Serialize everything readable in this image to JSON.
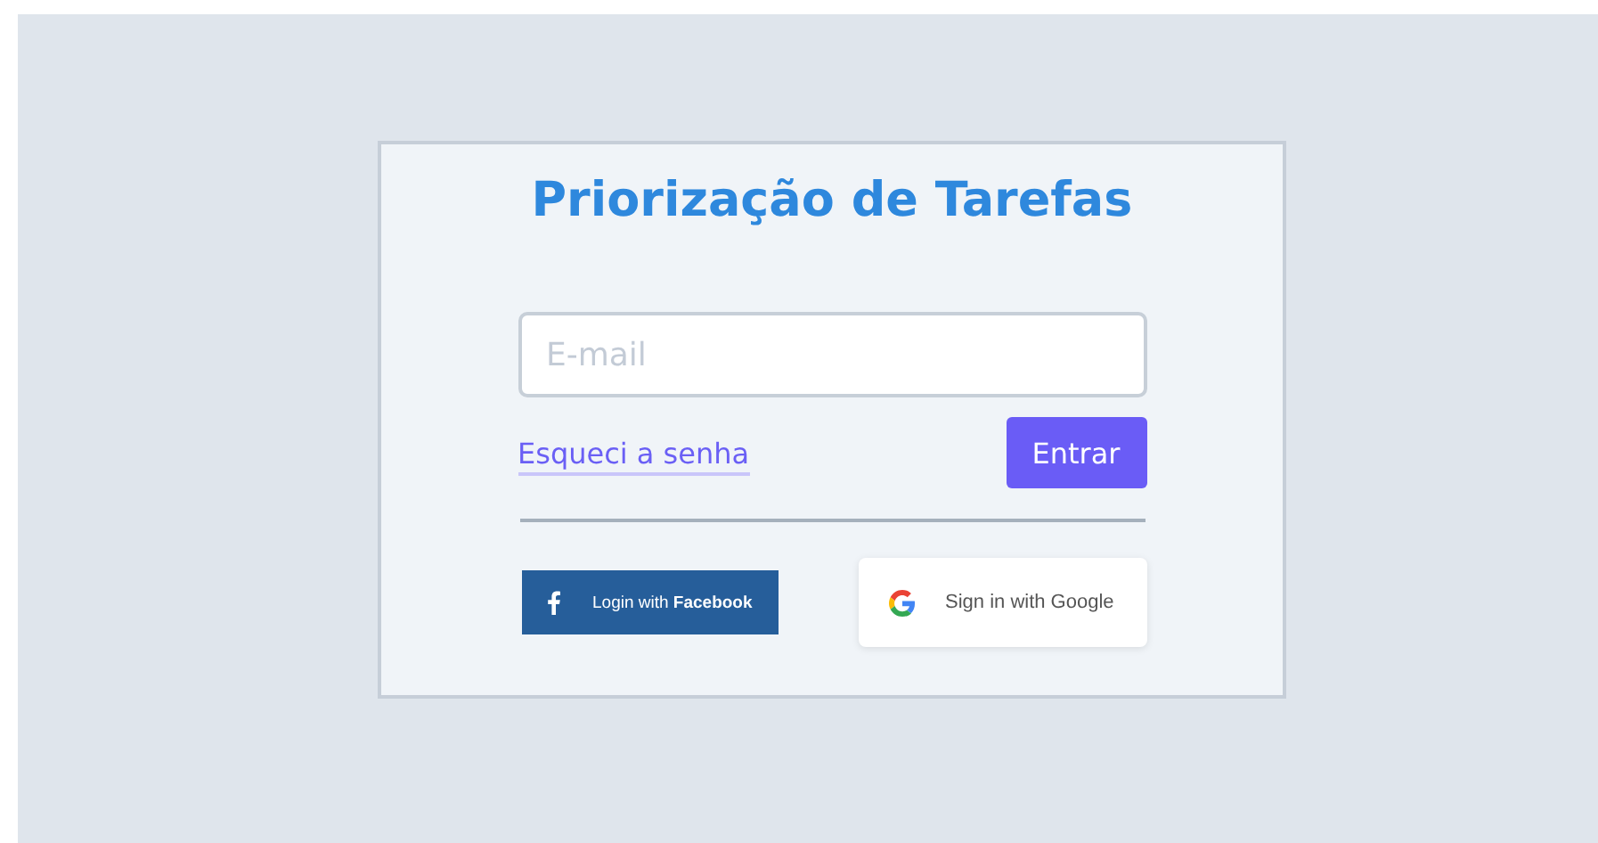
{
  "title": "Priorização de Tarefas",
  "email": {
    "placeholder": "E-mail"
  },
  "forgot_link": "Esqueci a senha",
  "submit_button": "Entrar",
  "social_buttons": [
    {
      "kind": "facebook",
      "label": "Login with **Facebook**"
    },
    {
      "kind": "google",
      "label": "Sign in with Google"
    }
  ]
}
